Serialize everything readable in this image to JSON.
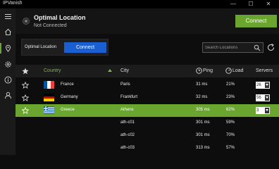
{
  "app": {
    "title": "IPVanish"
  },
  "window_controls": {
    "minimize": "—",
    "maximize": "☐",
    "close": "✕"
  },
  "header": {
    "title": "Optimal Location",
    "status": "Not Connected",
    "connect_label": "Connect"
  },
  "quick_connect": {
    "label": "Optimal Location",
    "button": "Connect"
  },
  "search": {
    "placeholder": "Search Locations"
  },
  "table": {
    "columns": {
      "country": "Country",
      "city": "City",
      "ping": "Ping",
      "load": "Load",
      "servers": "Servers"
    },
    "rows": [
      {
        "country": "France",
        "flag": "fr",
        "city": "Paris",
        "ping": "31 ms",
        "load": "21%",
        "servers": "26",
        "selected": false
      },
      {
        "country": "Germany",
        "flag": "de",
        "city": "Frankfurt",
        "ping": "32 ms",
        "load": "23%",
        "servers": "56",
        "selected": false
      },
      {
        "country": "Greece",
        "flag": "gr",
        "city": "Athens",
        "ping": "305 ms",
        "load": "62%",
        "servers": "3",
        "selected": true
      },
      {
        "country": "",
        "city": "ath-c01",
        "ping": "301 ms",
        "load": "59%"
      },
      {
        "country": "",
        "city": "ath-c02",
        "ping": "301 ms",
        "load": "70%"
      },
      {
        "country": "",
        "city": "ath-c03",
        "ping": "313 ms",
        "load": "57%"
      }
    ]
  },
  "colors": {
    "accent_green": "#6aa52f",
    "connect_blue": "#1a5fd1",
    "background": "#0d0d0d"
  }
}
